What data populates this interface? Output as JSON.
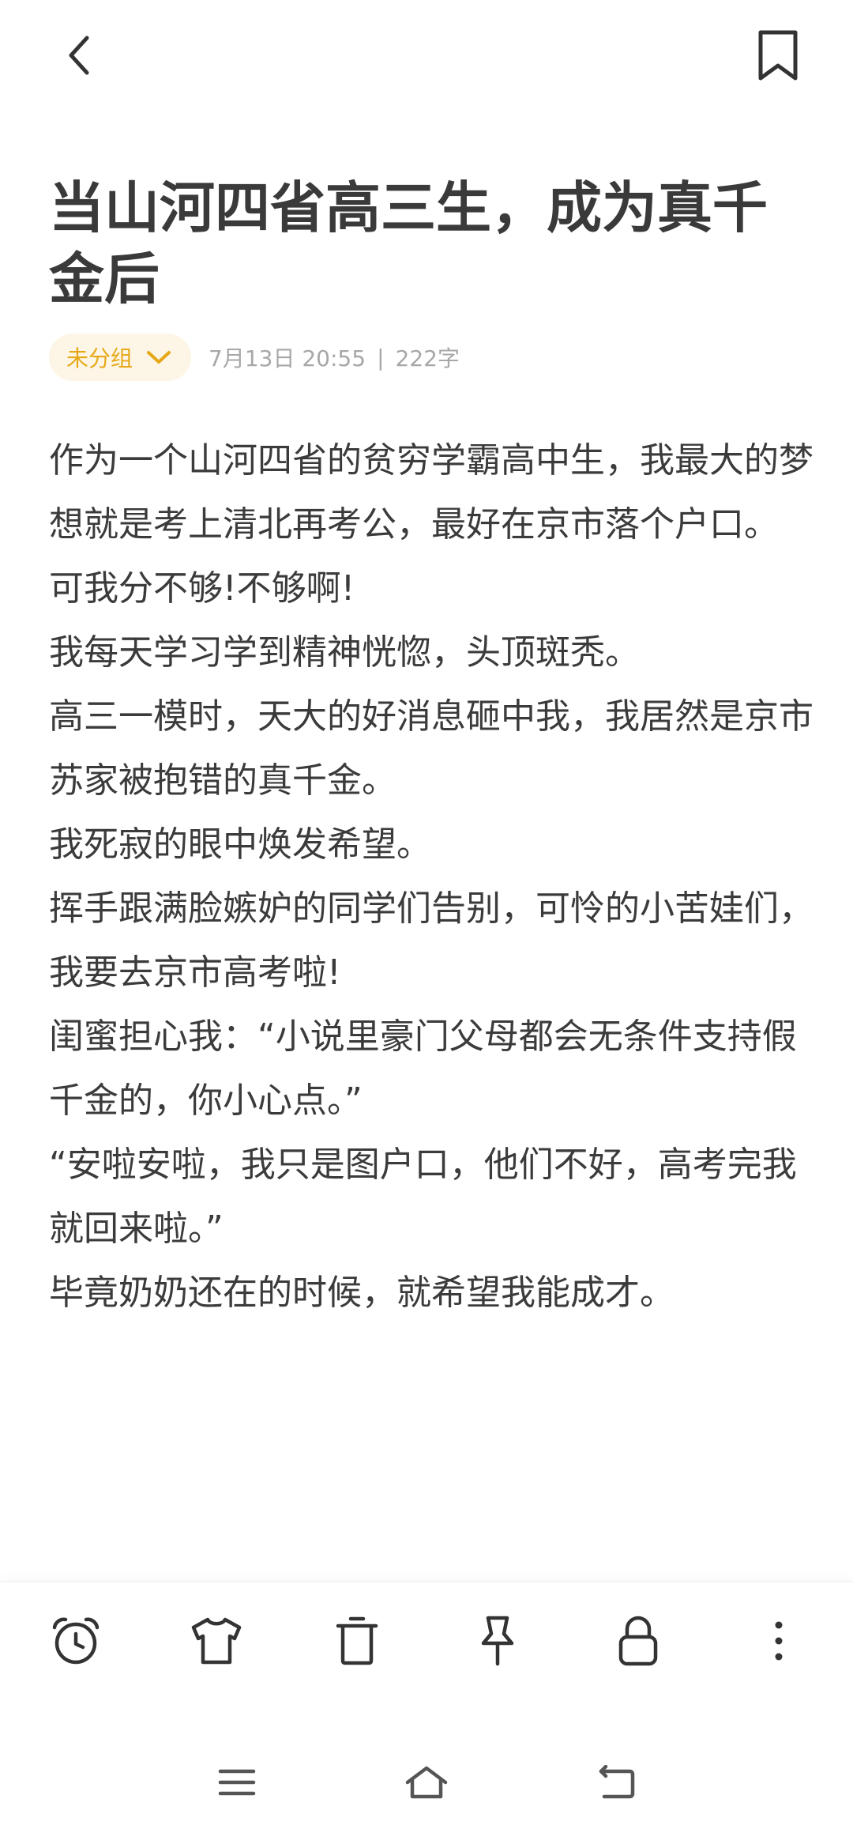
{
  "header": {
    "back_icon": "chevron-left-icon",
    "bookmark_icon": "bookmark-icon"
  },
  "note": {
    "title": "当山河四省高三生，成为真千金后",
    "group_label": "未分组",
    "date": "7月13日 20:55",
    "separator": "|",
    "word_count": "222字",
    "paragraphs": [
      "作为一个山河四省的贫穷学霸高中生，我最大的梦想就是考上清北再考公，最好在京市落个户口。",
      "可我分不够!不够啊!",
      "我每天学习学到精神恍惚，头顶斑秃。",
      "高三一模时，天大的好消息砸中我，我居然是京市苏家被抱错的真千金。",
      "我死寂的眼中焕发希望。",
      "挥手跟满脸嫉妒的同学们告别，可怜的小苦娃们，我要去京市高考啦!",
      "闺蜜担心我：“小说里豪门父母都会无条件支持假千金的，你小心点。”",
      "“安啦安啦，我只是图户口，他们不好，高考完我就回来啦。”",
      "毕竟奶奶还在的时候，就希望我能成才。"
    ]
  },
  "toolbar": {
    "items": [
      "alarm-clock-icon",
      "tshirt-icon",
      "trash-icon",
      "pin-icon",
      "lock-icon",
      "more-vertical-icon"
    ]
  },
  "navbar": {
    "items": [
      "menu-icon",
      "home-icon",
      "back-icon"
    ]
  },
  "colors": {
    "accent": "#e6a817",
    "chip_bg": "#fdf6e6",
    "text": "#3b3b3b",
    "meta": "#a7a7a7"
  }
}
